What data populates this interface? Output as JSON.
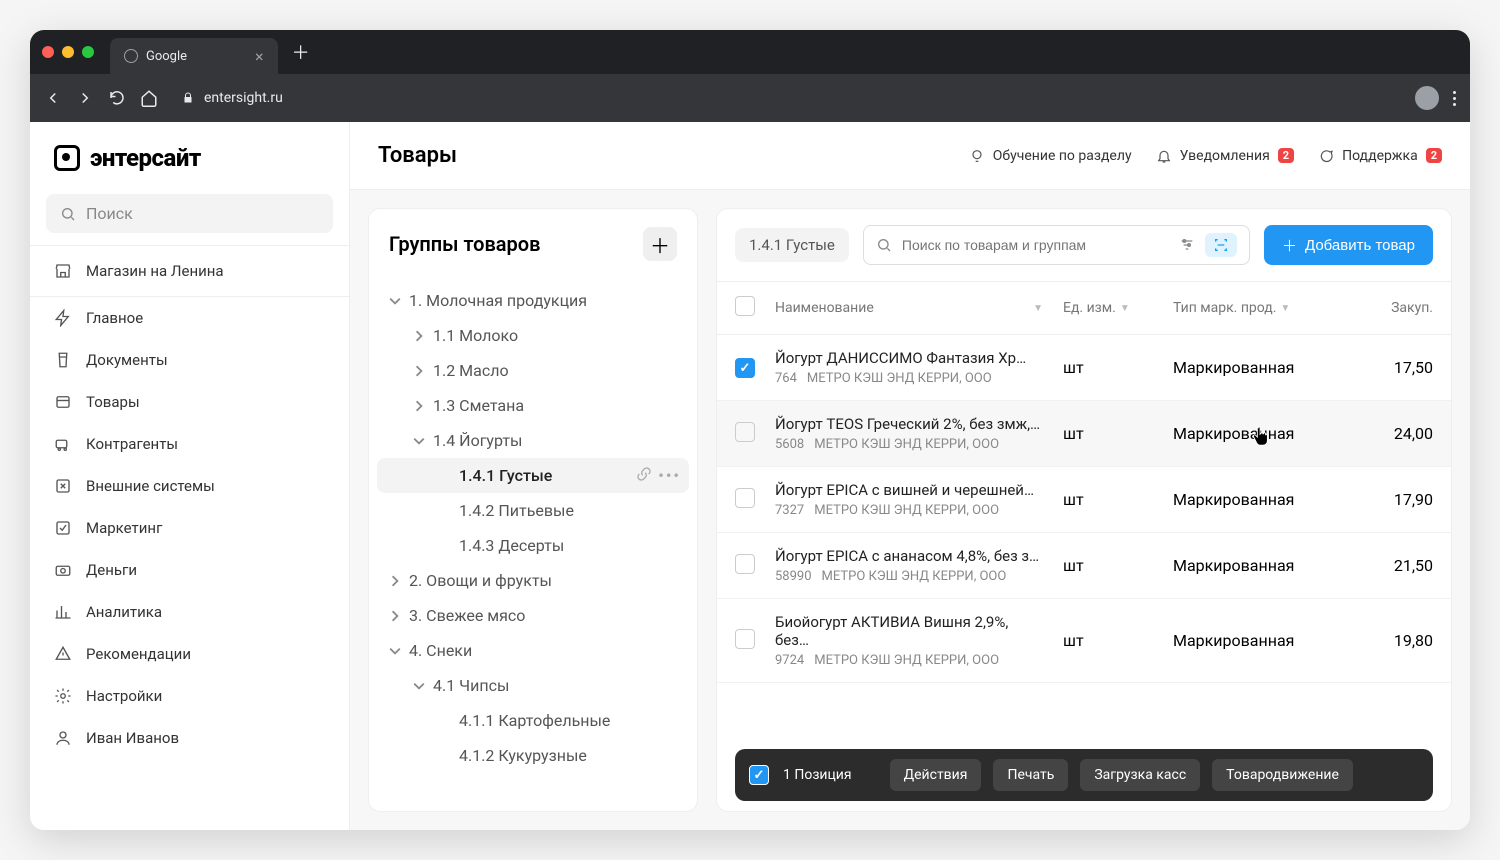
{
  "browser": {
    "tab_title": "Google",
    "url": "entersight.ru"
  },
  "brand": "энтерсайт",
  "sidebar": {
    "search_placeholder": "Поиск",
    "store": "Магазин на Ленина",
    "items": [
      {
        "label": "Главное"
      },
      {
        "label": "Документы"
      },
      {
        "label": "Товары"
      },
      {
        "label": "Контрагенты"
      },
      {
        "label": "Внешние системы"
      },
      {
        "label": "Маркетинг"
      },
      {
        "label": "Деньги"
      },
      {
        "label": "Аналитика"
      },
      {
        "label": "Рекомендации"
      },
      {
        "label": "Настройки"
      },
      {
        "label": "Иван Иванов"
      }
    ]
  },
  "topbar": {
    "title": "Товары",
    "training": "Обучение по разделу",
    "notifications": "Уведомления",
    "notifications_badge": "2",
    "support": "Поддержка",
    "support_badge": "2"
  },
  "groups": {
    "title": "Группы товаров",
    "tree": [
      {
        "level": 1,
        "caret": "down",
        "label": "1. Молочная продукция"
      },
      {
        "level": 2,
        "caret": "right",
        "label": "1.1 Молоко"
      },
      {
        "level": 2,
        "caret": "right",
        "label": "1.2 Масло"
      },
      {
        "level": 2,
        "caret": "right",
        "label": "1.3 Сметана"
      },
      {
        "level": 2,
        "caret": "down",
        "label": "1.4 Йогурты"
      },
      {
        "level": 3,
        "caret": "",
        "label": "1.4.1 Густые",
        "selected": true
      },
      {
        "level": 3,
        "caret": "",
        "label": "1.4.2 Питьевые"
      },
      {
        "level": 3,
        "caret": "",
        "label": "1.4.3 Десерты"
      },
      {
        "level": 1,
        "caret": "right",
        "label": "2. Овощи и фрукты"
      },
      {
        "level": 1,
        "caret": "right",
        "label": "3. Свежее мясо"
      },
      {
        "level": 1,
        "caret": "down",
        "label": "4. Снеки"
      },
      {
        "level": 2,
        "caret": "down",
        "label": "4.1 Чипсы"
      },
      {
        "level": 3,
        "caret": "",
        "label": "4.1.1 Картофельные"
      },
      {
        "level": 3,
        "caret": "",
        "label": "4.1.2 Кукурузные"
      }
    ]
  },
  "products": {
    "breadcrumb": "1.4.1 Густые",
    "search_placeholder": "Поиск по товарам и группам",
    "add_button": "Добавить товар",
    "columns": {
      "name": "Наименование",
      "unit": "Ед. изм.",
      "mark": "Тип марк. прод.",
      "price": "Закуп."
    },
    "rows": [
      {
        "checked": true,
        "name": "Йогурт ДАНИССИМО Фантазия Хр…",
        "sku": "764",
        "supplier": "МЕТРО КЭШ ЭНД КЕРРИ, ООО",
        "unit": "шт",
        "mark": "Маркированная",
        "price": "17,50"
      },
      {
        "checked": false,
        "name": "Йогурт TEOS Греческий 2%, без змж,…",
        "sku": "5608",
        "supplier": "МЕТРО КЭШ ЭНД КЕРРИ, ООО",
        "unit": "шт",
        "mark": "Маркированная",
        "price": "24,00",
        "hovered": true
      },
      {
        "checked": false,
        "name": "Йогурт EPICA с вишней и черешней…",
        "sku": "7327",
        "supplier": "МЕТРО КЭШ ЭНД КЕРРИ, ООО",
        "unit": "шт",
        "mark": "Маркированная",
        "price": "17,90"
      },
      {
        "checked": false,
        "name": "Йогурт EPICA с ананасом 4,8%, без з…",
        "sku": "58990",
        "supplier": "МЕТРО КЭШ ЭНД КЕРРИ, ООО",
        "unit": "шт",
        "mark": "Маркированная",
        "price": "21,50"
      },
      {
        "checked": false,
        "name": "Биойогурт АКТИВИА Вишня 2,9%, без…",
        "sku": "9724",
        "supplier": "МЕТРО КЭШ ЭНД КЕРРИ, ООО",
        "unit": "шт",
        "mark": "Маркированная",
        "price": "19,80"
      }
    ]
  },
  "action_bar": {
    "count_label": "1 Позиция",
    "actions": [
      "Действия",
      "Печать",
      "Загрузка касс",
      "Товародвижение"
    ]
  }
}
